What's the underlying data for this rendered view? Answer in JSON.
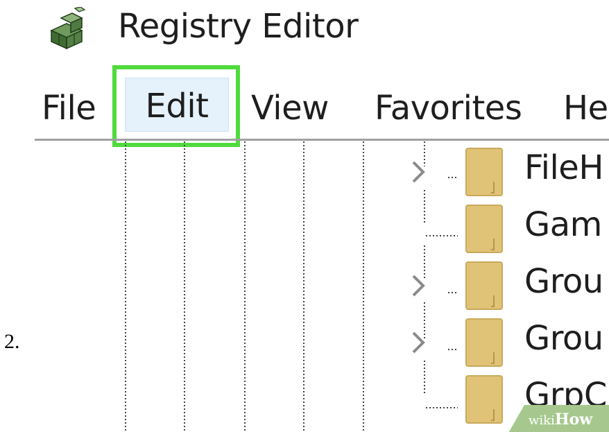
{
  "step_number": "2.",
  "window": {
    "title": "Registry Editor",
    "icon": "registry-editor-icon"
  },
  "menu": {
    "items": [
      {
        "label": "File"
      },
      {
        "label": "Edit",
        "highlighted": true
      },
      {
        "label": "View"
      },
      {
        "label": "Favorites"
      },
      {
        "label": "He"
      }
    ]
  },
  "tree": {
    "nodes": [
      {
        "label": "FileH",
        "expandable": true
      },
      {
        "label": "Gam",
        "expandable": false
      },
      {
        "label": "Grou",
        "expandable": true
      },
      {
        "label": "Grou",
        "expandable": true
      },
      {
        "label": "GrpC",
        "expandable": false
      }
    ]
  },
  "watermark": {
    "prefix": "wiki",
    "suffix": "How"
  },
  "colors": {
    "highlight": "#4fdb3c",
    "menu_hover": "#e5f1fb",
    "folder": "#e0c377",
    "watermark": "#a6c88e"
  }
}
